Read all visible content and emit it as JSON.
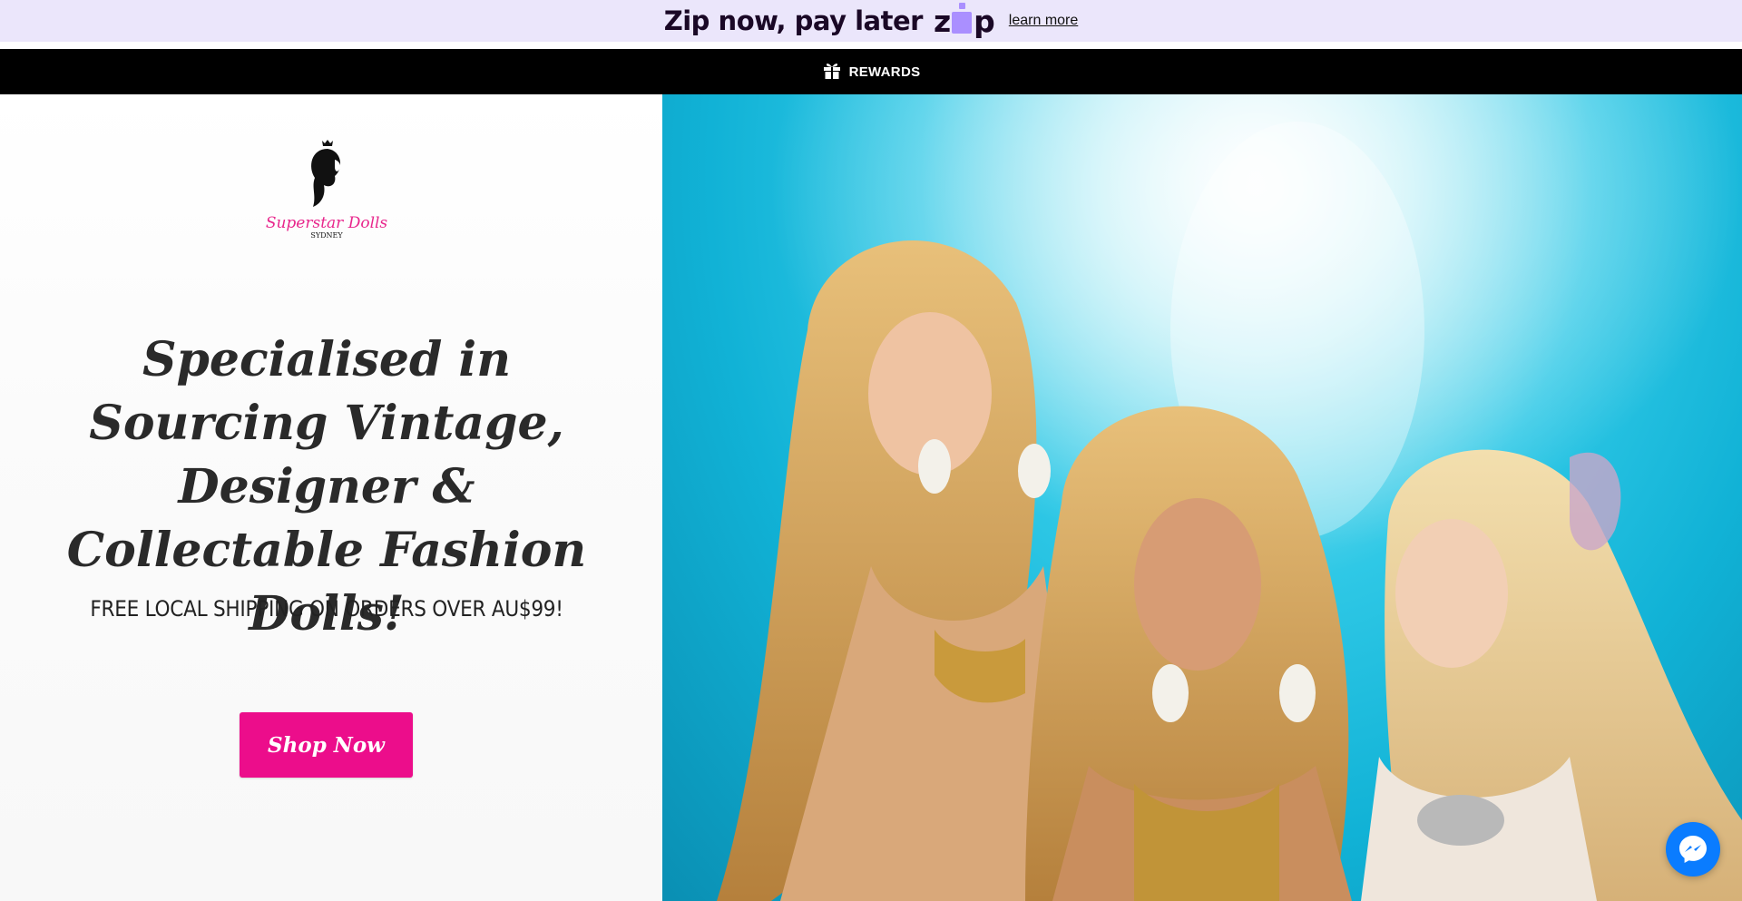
{
  "zip_banner": {
    "text": "Zip now, pay later",
    "logo_text": "zip",
    "learn_more": "learn more",
    "accent_color": "#aa8fff"
  },
  "rewards": {
    "icon": "gift-icon",
    "label": "REWARDS"
  },
  "brand": {
    "name": "Superstar Dolls",
    "sub": "SYDNEY",
    "color": "#e8268c"
  },
  "hero": {
    "headline": "Specialised in Sourcing Vintage, Designer & Collectable Fashion Dolls!",
    "shipping": "FREE LOCAL SHIPPING ON ORDERS OVER AU$99!",
    "cta": "Shop Now",
    "cta_color": "#ec0d8b"
  },
  "chat": {
    "icon": "messenger-icon"
  }
}
